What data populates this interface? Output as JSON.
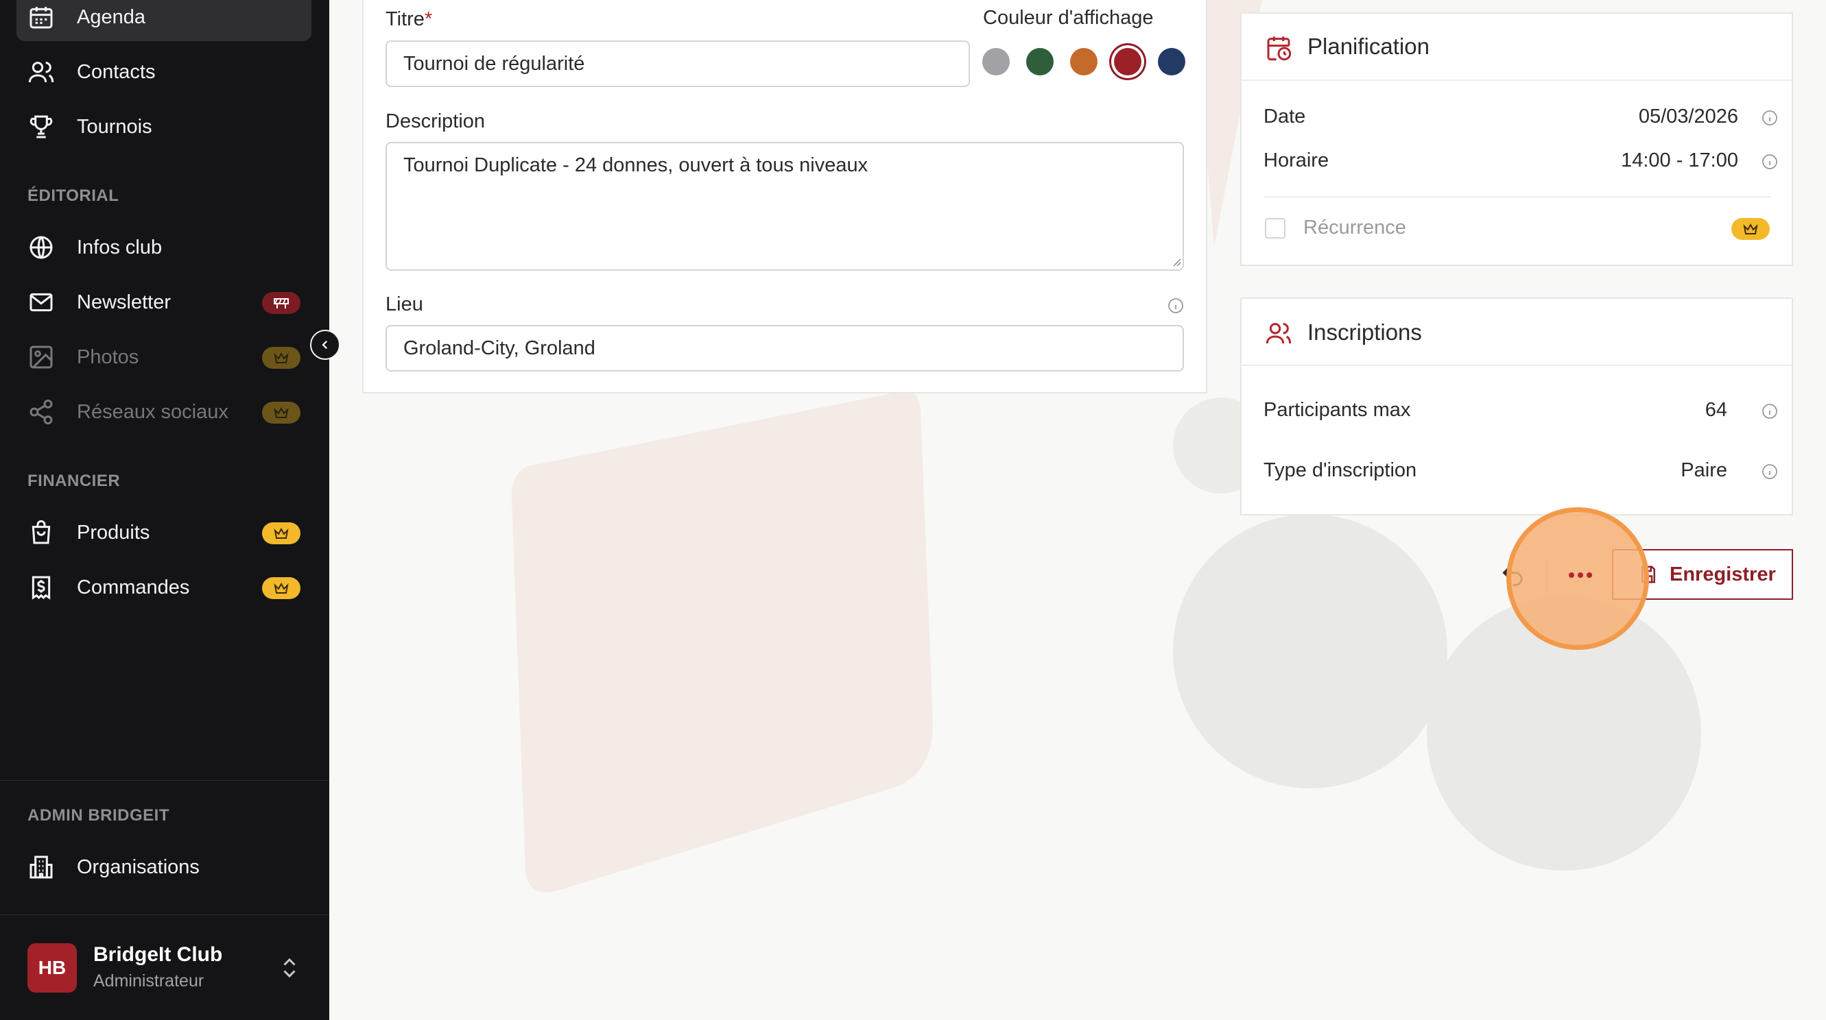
{
  "sidebar": {
    "items": [
      {
        "label": "Agenda",
        "icon": "calendar-icon"
      },
      {
        "label": "Contacts",
        "icon": "users-icon"
      },
      {
        "label": "Tournois",
        "icon": "trophy-icon"
      },
      {
        "label": "Infos club",
        "icon": "globe-icon"
      },
      {
        "label": "Newsletter",
        "icon": "mail-icon"
      },
      {
        "label": "Photos",
        "icon": "image-icon"
      },
      {
        "label": "Réseaux sociaux",
        "icon": "share-icon"
      },
      {
        "label": "Produits",
        "icon": "shopping-bag-icon"
      },
      {
        "label": "Commandes",
        "icon": "receipt-icon"
      },
      {
        "label": "Organisations",
        "icon": "building-icon"
      }
    ],
    "sections": {
      "editorial": "ÉDITORIAL",
      "financier": "FINANCIER",
      "admin": "ADMIN BRIDGEIT"
    },
    "user": {
      "initials": "HB",
      "name": "BridgeIt Club",
      "role": "Administrateur"
    }
  },
  "form": {
    "title_label": "Titre",
    "required_mark": "*",
    "title_value": "Tournoi de régularité",
    "color_label": "Couleur d'affichage",
    "colors": [
      "#a1a1a6",
      "#2e5e3a",
      "#c46a2a",
      "#9b2028",
      "#233b64"
    ],
    "selected_color": "#9b2028",
    "description_label": "Description",
    "description_value": "Tournoi Duplicate - 24 donnes, ouvert à tous niveaux",
    "location_label": "Lieu",
    "location_value": "Groland-City, Groland"
  },
  "planning": {
    "title": "Planification",
    "date_label": "Date",
    "date_value": "05/03/2026",
    "time_label": "Horaire",
    "time_value": "14:00 - 17:00",
    "recurrence_label": "Récurrence"
  },
  "registrations": {
    "title": "Inscriptions",
    "max_label": "Participants max",
    "max_value": "64",
    "type_label": "Type d'inscription",
    "type_value": "Paire"
  },
  "actions": {
    "save_label": "Enregistrer"
  }
}
